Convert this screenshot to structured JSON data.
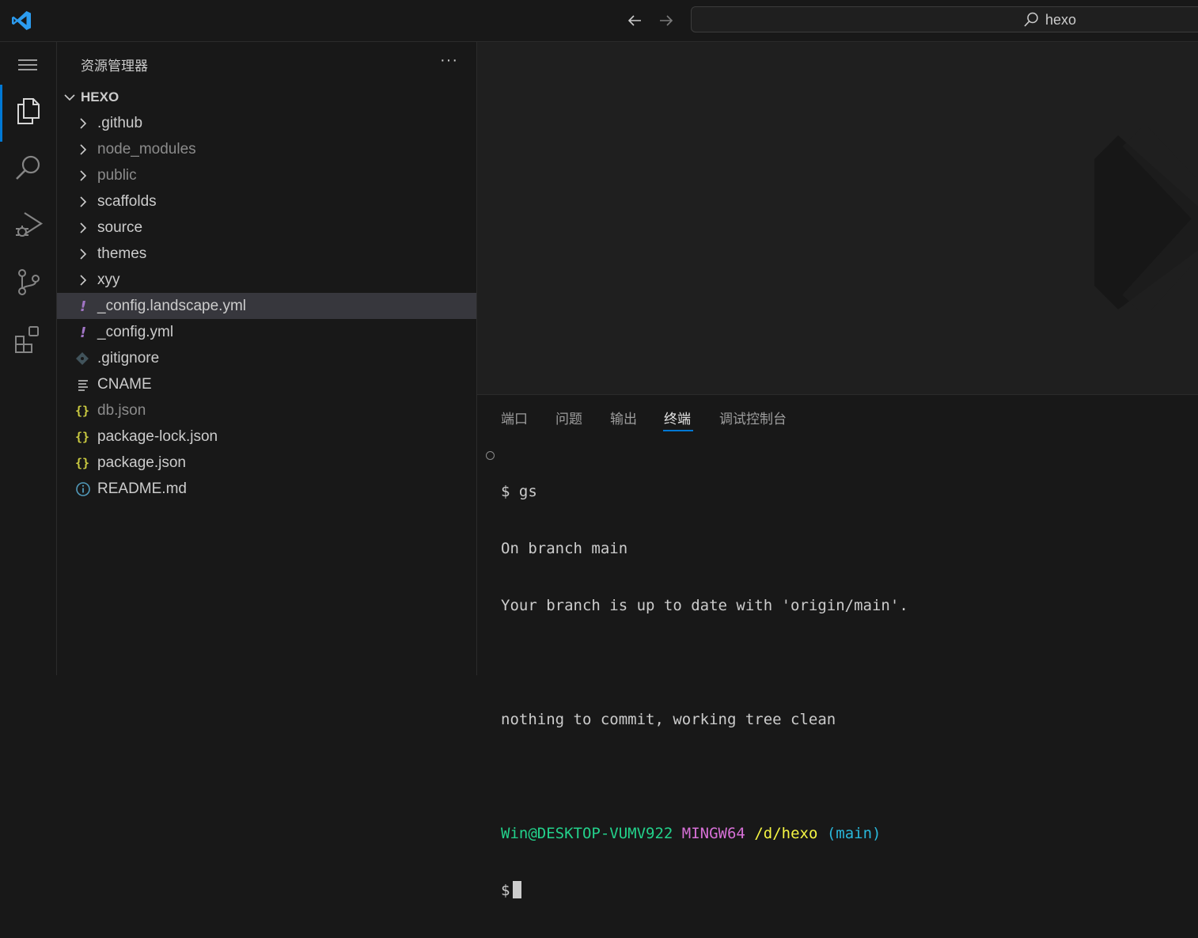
{
  "titlebar": {
    "search_label": "hexo"
  },
  "sidebar": {
    "title": "资源管理器",
    "more": "···",
    "folder_name": "HEXO",
    "items": [
      {
        "label": ".github",
        "kind": "folder",
        "tone": "normal"
      },
      {
        "label": "node_modules",
        "kind": "folder",
        "tone": "dim"
      },
      {
        "label": "public",
        "kind": "folder",
        "tone": "dim"
      },
      {
        "label": "scaffolds",
        "kind": "folder",
        "tone": "normal"
      },
      {
        "label": "source",
        "kind": "folder",
        "tone": "normal"
      },
      {
        "label": "themes",
        "kind": "folder",
        "tone": "normal"
      },
      {
        "label": "xyy",
        "kind": "folder",
        "tone": "normal"
      },
      {
        "label": "_config.landscape.yml",
        "kind": "yml",
        "tone": "normal",
        "selected": true
      },
      {
        "label": "_config.yml",
        "kind": "yml",
        "tone": "normal"
      },
      {
        "label": ".gitignore",
        "kind": "git",
        "tone": "normal"
      },
      {
        "label": "CNAME",
        "kind": "text",
        "tone": "normal"
      },
      {
        "label": "db.json",
        "kind": "json",
        "tone": "dim"
      },
      {
        "label": "package-lock.json",
        "kind": "json",
        "tone": "normal"
      },
      {
        "label": "package.json",
        "kind": "json",
        "tone": "normal"
      },
      {
        "label": "README.md",
        "kind": "info",
        "tone": "normal"
      }
    ]
  },
  "panel": {
    "tabs": [
      "端口",
      "问题",
      "输出",
      "终端",
      "调试控制台"
    ],
    "active_tab": "终端"
  },
  "terminal": {
    "prompt_symbol": "$",
    "command": "gs",
    "output": [
      "On branch main",
      "Your branch is up to date with 'origin/main'.",
      "",
      "nothing to commit, working tree clean",
      ""
    ],
    "prompt_user": "Win@DESKTOP-VUMV922",
    "prompt_shell": "MINGW64",
    "prompt_path": "/d/hexo",
    "prompt_branch": "(main)"
  },
  "colors": {
    "accent": "#0078d4",
    "yml_icon": "#a074c4",
    "json_icon": "#cbcb41",
    "git_icon": "#41535b",
    "info_icon": "#519aba"
  },
  "icons": {
    "activity": [
      "menu-icon",
      "explorer-icon",
      "search-icon",
      "run-debug-icon",
      "source-control-icon",
      "extensions-icon"
    ]
  }
}
